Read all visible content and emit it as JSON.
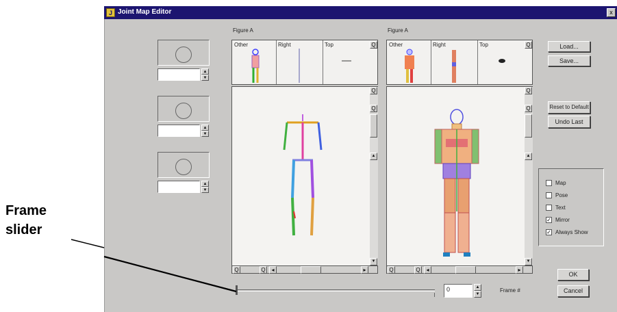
{
  "window": {
    "title": "Joint Map Editor",
    "close_glyph": "x"
  },
  "callout": {
    "line1": "Frame",
    "line2": "slider"
  },
  "left_panel": {
    "label": "Figure A",
    "thumbs": [
      "Other",
      "Right",
      "Top"
    ]
  },
  "right_panel": {
    "label": "Figure A",
    "thumbs": [
      "Other",
      "Right",
      "Top"
    ]
  },
  "buttons": {
    "load": "Load...",
    "save": "Save...",
    "reset": "Reset to Default",
    "undo": "Undo Last",
    "ok": "OK",
    "cancel": "Cancel"
  },
  "options": [
    {
      "label": "Map",
      "checked": false
    },
    {
      "label": "Pose",
      "checked": false
    },
    {
      "label": "Text",
      "checked": false
    },
    {
      "label": "Mirror",
      "checked": true
    },
    {
      "label": "Always Show",
      "checked": true
    }
  ],
  "frame": {
    "value": "0",
    "label": "Frame #"
  },
  "glyphs": {
    "up": "▲",
    "down": "▼",
    "left": "◂",
    "right": "▸",
    "check": "✓",
    "zoom": "Q"
  },
  "colors": {
    "titlebar": "#1c1570",
    "dialog": "#c9c8c6"
  }
}
